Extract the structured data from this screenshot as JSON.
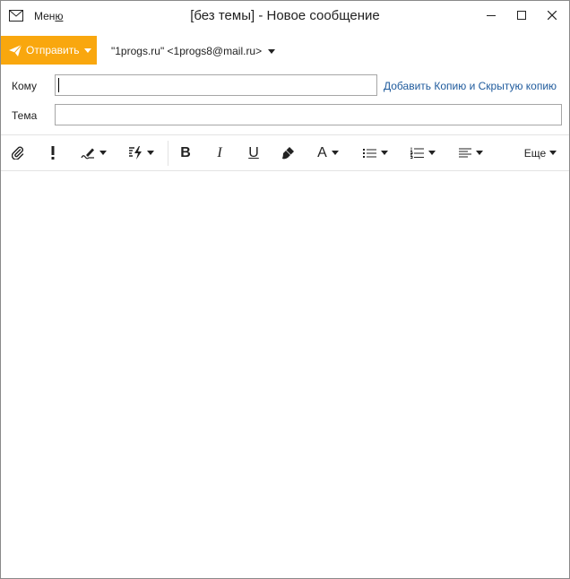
{
  "window": {
    "title": "[без темы] - Новое сообщение",
    "menu_label_prefix": "Мен",
    "menu_label_underlined": "ю"
  },
  "icons": {
    "app": "envelope-icon",
    "minimize": "minimize-icon",
    "maximize": "maximize-icon",
    "close": "close-icon",
    "send": "paper-plane-icon",
    "attach": "paperclip-icon",
    "importance": "exclamation-icon",
    "signature": "signature-pen-icon",
    "templates": "lightning-icon",
    "bold": "bold-icon",
    "italic": "italic-icon",
    "underline": "underline-icon",
    "clear_format": "brush-icon",
    "font_color": "font-color-icon",
    "bullets": "bullet-list-icon",
    "numbering": "numbered-list-icon",
    "align": "align-icon"
  },
  "compose": {
    "send_label": "Отправить",
    "from": "\"1progs.ru\" <1progs8@mail.ru>",
    "to_label": "Кому",
    "to_value": "",
    "subject_label": "Тема",
    "subject_value": "",
    "add_cc_bcc": "Добавить Копию и Скрытую копию"
  },
  "toolbar": {
    "bold_glyph": "B",
    "italic_glyph": "I",
    "underline_glyph": "U",
    "font_glyph": "A",
    "more_label": "Еще"
  },
  "colors": {
    "send_button": "#f9a70e",
    "link": "#1e5a9c"
  }
}
